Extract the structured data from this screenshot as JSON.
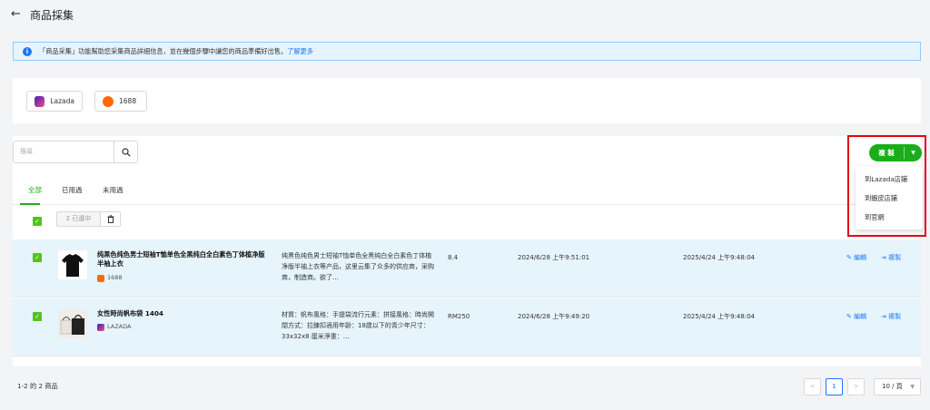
{
  "header": {
    "back_icon": "arrow-left-icon",
    "title": "商品採集"
  },
  "info": {
    "text": "「商品采集」功能幫助您采集商品詳細信息，並在幾個步驟中讓您的商品準備好出售。",
    "link": "了解更多"
  },
  "platforms": [
    {
      "label": "Lazada",
      "icon": "lazada-icon"
    },
    {
      "label": "1688",
      "icon": "1688-icon"
    }
  ],
  "search": {
    "placeholder": "搜尋",
    "icon": "search-icon"
  },
  "tabs": [
    {
      "label": "全部",
      "active": true
    },
    {
      "label": "已用過"
    },
    {
      "label": "未用過"
    }
  ],
  "selection": {
    "count_label": "2 已選中",
    "delete_icon": "trash-icon"
  },
  "copy_button": {
    "label": "複 製",
    "caret_icon": "chevron-down-icon"
  },
  "copy_menu": [
    "到Lazada店鋪",
    "到蝦皮店鋪",
    "到官網"
  ],
  "rows": [
    {
      "name": "纯黑色纯色男士短袖T恤单色全黑纯白全白素色丁体植净版半袖上衣",
      "source": "1688",
      "description": "纯黑色纯色男士短袖T恤单色全黑纯白全白素色丁体植净版半袖上衣等产品，这里云集了众多的供应商，采购商，制造商。欲了…",
      "price": "8.4",
      "created": "2024/6/28 上午9:51:01",
      "updated": "2025/4/24 上午9:48:04",
      "edit": "編輯",
      "copy": "複製"
    },
    {
      "name": "女性時尚帆布袋 1404",
      "source": "LAZADA",
      "description": "材質：帆布風格：手提袋流行元素：拼接風格：時尚開閉方式：拉鍊扣適用年齡：18歲以下的青少年尺寸：33x32x8 厘米淨重：…",
      "price": "RM250",
      "created": "2024/6/28 上午9:49:20",
      "updated": "2025/4/24 上午9:48:04",
      "edit": "編輯",
      "copy": "複製"
    }
  ],
  "footer": {
    "count": "1-2 的 2 商品",
    "current_page": "1",
    "page_size": "10 / 頁",
    "prev": "<",
    "next": ">"
  },
  "colors": {
    "accent_green": "#1aad19",
    "link_blue": "#1677ff",
    "highlight_red": "#e60012",
    "row_bg": "#e6f4fb"
  }
}
